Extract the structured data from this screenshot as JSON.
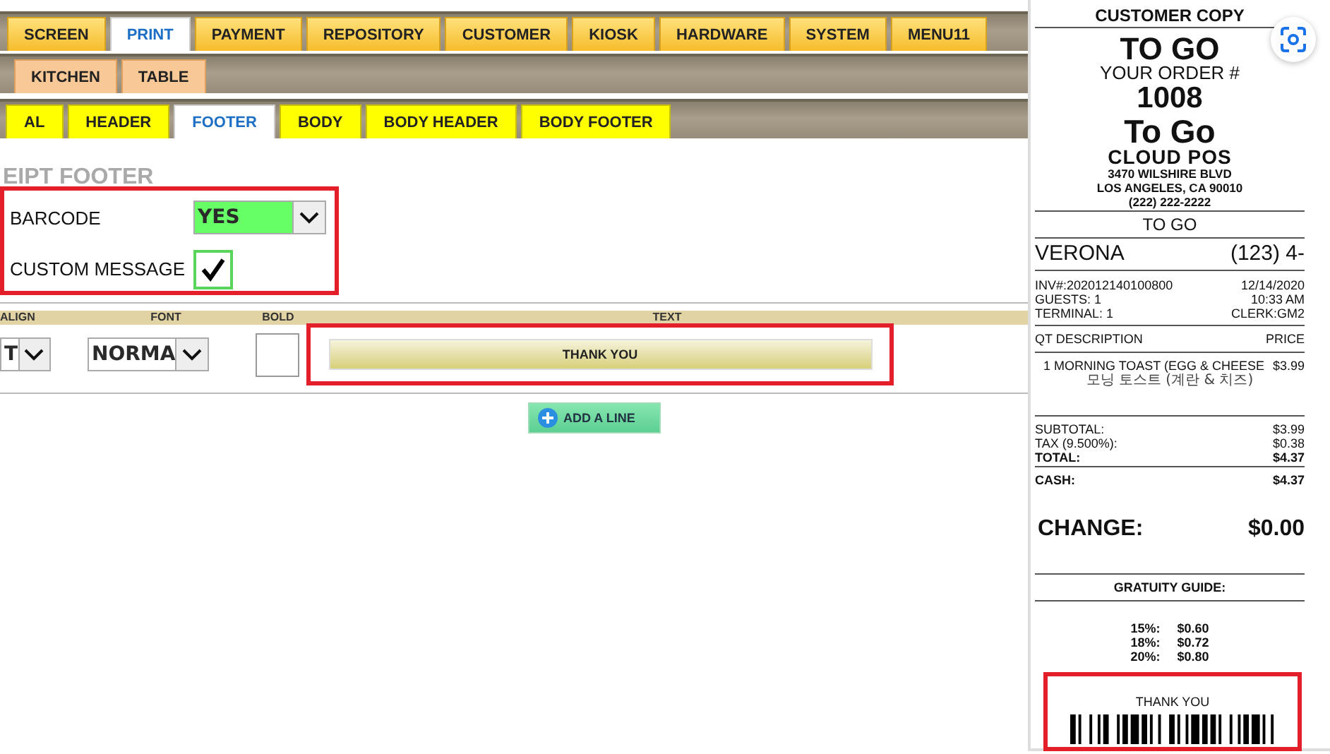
{
  "main_tabs": [
    {
      "label": "SCREEN",
      "selected": false
    },
    {
      "label": "PRINT",
      "selected": true
    },
    {
      "label": "PAYMENT",
      "selected": false
    },
    {
      "label": "REPOSITORY",
      "selected": false
    },
    {
      "label": "CUSTOMER",
      "selected": false
    },
    {
      "label": "KIOSK",
      "selected": false
    },
    {
      "label": "HARDWARE",
      "selected": false
    },
    {
      "label": "SYSTEM",
      "selected": false
    },
    {
      "label": "MENU11",
      "selected": false
    }
  ],
  "sub_tabs": [
    {
      "label": "KITCHEN",
      "selected": false
    },
    {
      "label": "TABLE",
      "selected": false
    }
  ],
  "section_tabs": [
    {
      "label": "AL",
      "selected": false
    },
    {
      "label": "HEADER",
      "selected": false
    },
    {
      "label": "FOOTER",
      "selected": true
    },
    {
      "label": "BODY",
      "selected": false
    },
    {
      "label": "BODY HEADER",
      "selected": false
    },
    {
      "label": "BODY FOOTER",
      "selected": false
    }
  ],
  "section_title": "EIPT FOOTER",
  "settings": {
    "barcode": {
      "label": "BARCODE",
      "value": "YES"
    },
    "custom_message": {
      "label": "CUSTOM MESSAGE",
      "checked": true
    }
  },
  "lines_table": {
    "columns": [
      "ALIGN",
      "FONT",
      "BOLD",
      "TEXT"
    ],
    "rows": [
      {
        "align": "T",
        "font": "NORMA",
        "bold": false,
        "text": "THANK YOU"
      }
    ]
  },
  "add_line_button": "ADD A LINE",
  "receipt": {
    "copy_label": "CUSTOMER COPY",
    "order_type": "TO GO",
    "order_label": "YOUR ORDER #",
    "order_number": "1008",
    "order_type_alt": "To Go",
    "store_name": "CLOUD POS",
    "address_lines": [
      "3470 WILSHIRE BLVD",
      "LOS ANGELES, CA 90010",
      "(222) 222-2222"
    ],
    "service_type": "TO GO",
    "customer_name": "VERONA",
    "customer_phone": "(123) 4-",
    "info_rows": [
      {
        "left": "INV#:202012140100800",
        "right": "12/14/2020"
      },
      {
        "left": "GUESTS: 1",
        "right": "10:33 AM"
      },
      {
        "left": "TERMINAL: 1",
        "right": "CLERK:GM2"
      }
    ],
    "columns": [
      "QT DESCRIPTION",
      "PRICE"
    ],
    "items": [
      {
        "name": "1 MORNING TOAST (EGG & CHEESE",
        "price": "$3.99",
        "translation": "모닝 토스트 (계란 & 치즈)"
      }
    ],
    "totals": [
      {
        "label": "SUBTOTAL:",
        "amount": "$3.99",
        "bold": false
      },
      {
        "label": "TAX (9.500%):",
        "amount": "$0.38",
        "bold": false
      },
      {
        "label": "TOTAL:",
        "amount": "$4.37",
        "bold": true
      }
    ],
    "payments": [
      {
        "label": "CASH:",
        "amount": "$4.37",
        "bold": true
      }
    ],
    "change_label": "CHANGE:",
    "change_amount": "$0.00",
    "gratuity_title": "GRATUITY GUIDE:",
    "gratuity": [
      {
        "percent": "15%:",
        "amount": "$0.60"
      },
      {
        "percent": "18%:",
        "amount": "$0.72"
      },
      {
        "percent": "20%:",
        "amount": "$0.80"
      }
    ],
    "footer_message": "THANK YOU"
  }
}
